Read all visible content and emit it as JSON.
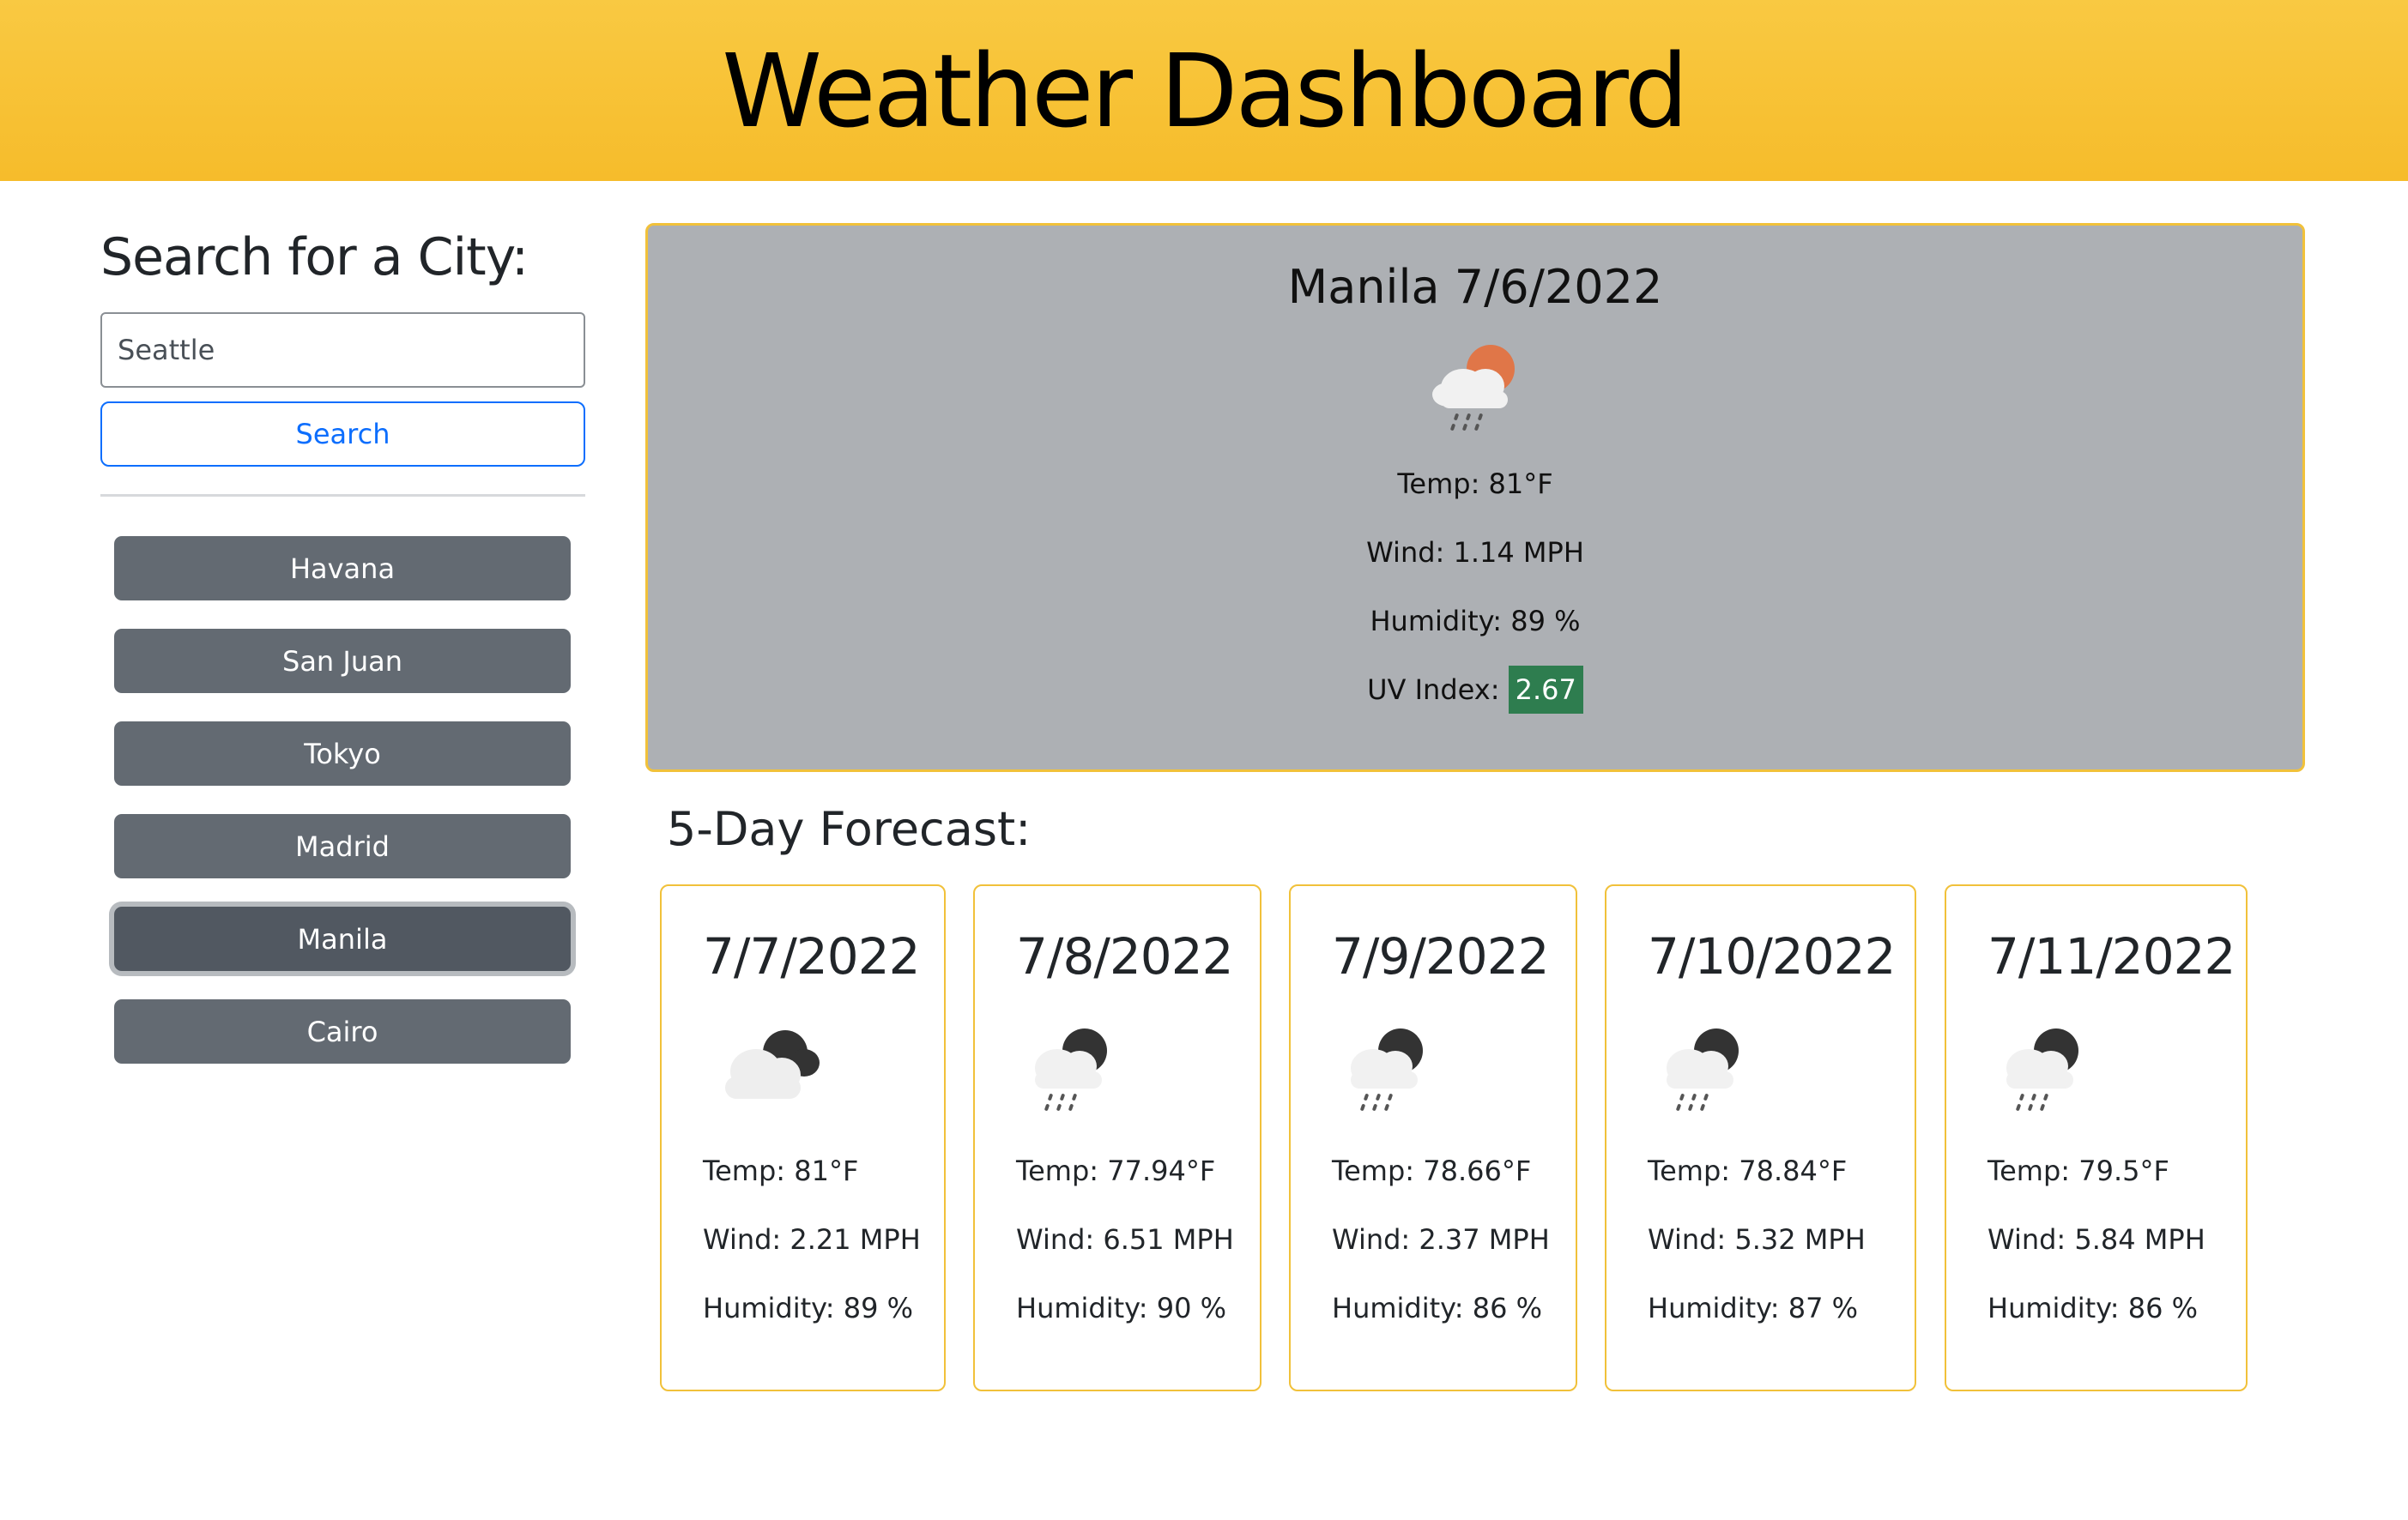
{
  "header": {
    "title": "Weather Dashboard"
  },
  "sidebar": {
    "heading": "Search for a City:",
    "search_value": "Seattle",
    "search_button": "Search",
    "cities": [
      "Havana",
      "San Juan",
      "Tokyo",
      "Madrid",
      "Manila",
      "Cairo"
    ],
    "active_city": "Manila"
  },
  "current": {
    "title": "Manila 7/6/2022",
    "icon": "rain-sun-icon",
    "temp": "Temp: 81°F",
    "wind": "Wind: 1.14 MPH",
    "humidity": "Humidity: 89 %",
    "uv_label": "UV Index:",
    "uv_value": "2.67",
    "uv_color": "#2e7d4f"
  },
  "forecast": {
    "title": "5-Day Forecast:",
    "days": [
      {
        "date": "7/7/2022",
        "icon": "cloudy-night-icon",
        "temp": "Temp: 81°F",
        "wind": "Wind: 2.21 MPH",
        "humidity": "Humidity: 89 %"
      },
      {
        "date": "7/8/2022",
        "icon": "rain-night-icon",
        "temp": "Temp: 77.94°F",
        "wind": "Wind: 6.51 MPH",
        "humidity": "Humidity: 90 %"
      },
      {
        "date": "7/9/2022",
        "icon": "rain-night-icon",
        "temp": "Temp: 78.66°F",
        "wind": "Wind: 2.37 MPH",
        "humidity": "Humidity: 86 %"
      },
      {
        "date": "7/10/2022",
        "icon": "rain-night-icon",
        "temp": "Temp: 78.84°F",
        "wind": "Wind: 5.32 MPH",
        "humidity": "Humidity: 87 %"
      },
      {
        "date": "7/11/2022",
        "icon": "rain-night-icon",
        "temp": "Temp: 79.5°F",
        "wind": "Wind: 5.84 MPH",
        "humidity": "Humidity: 86 %"
      }
    ]
  },
  "colors": {
    "header_bg": "#f7c130",
    "accent_border": "#f1c13a",
    "city_button": "#636a72",
    "search_button": "#0d6efd"
  }
}
